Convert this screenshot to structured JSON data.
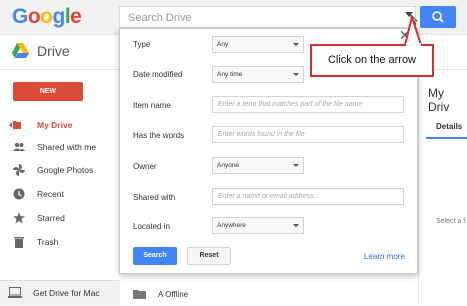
{
  "header": {
    "logo_letters": [
      "G",
      "o",
      "o",
      "g",
      "l",
      "e"
    ],
    "search_placeholder": "Search Drive",
    "app_name": "Drive"
  },
  "sidebar": {
    "new_label": "NEW",
    "items": [
      {
        "label": "My Drive",
        "icon": "drive-folder-icon",
        "active": true
      },
      {
        "label": "Shared with me",
        "icon": "people-icon"
      },
      {
        "label": "Google Photos",
        "icon": "pinwheel-icon"
      },
      {
        "label": "Recent",
        "icon": "clock-icon"
      },
      {
        "label": "Starred",
        "icon": "star-icon"
      },
      {
        "label": "Trash",
        "icon": "trash-icon"
      }
    ],
    "get_drive_label": "Get Drive for Mac"
  },
  "right_panel": {
    "heading": "My Driv",
    "details_tab": "Details",
    "select_note": "Select a f"
  },
  "files": [
    {
      "name": "A Offline"
    }
  ],
  "search_panel": {
    "fields": [
      {
        "label": "Type",
        "kind": "select",
        "value": "Any"
      },
      {
        "label": "Date modified",
        "kind": "select",
        "value": "Any time"
      },
      {
        "label": "Item name",
        "kind": "input",
        "placeholder": "Enter a term that matches part of the file name"
      },
      {
        "label": "Has the words",
        "kind": "input",
        "placeholder": "Enter words found in the file"
      },
      {
        "label": "Owner",
        "kind": "select",
        "value": "Anyone"
      },
      {
        "label": "Shared with",
        "kind": "input",
        "placeholder": "Enter a name or email address..."
      },
      {
        "label": "Located in",
        "kind": "select",
        "value": "Anywhere"
      }
    ],
    "search_button": "Search",
    "reset_button": "Reset",
    "learn_more": "Learn more",
    "close_icon": "close-icon"
  },
  "callout": {
    "text": "Click on the arrow"
  },
  "colors": {
    "accent_blue": "#4285f4",
    "new_red": "#dd4b39",
    "callout_red": "#d32f2f"
  }
}
